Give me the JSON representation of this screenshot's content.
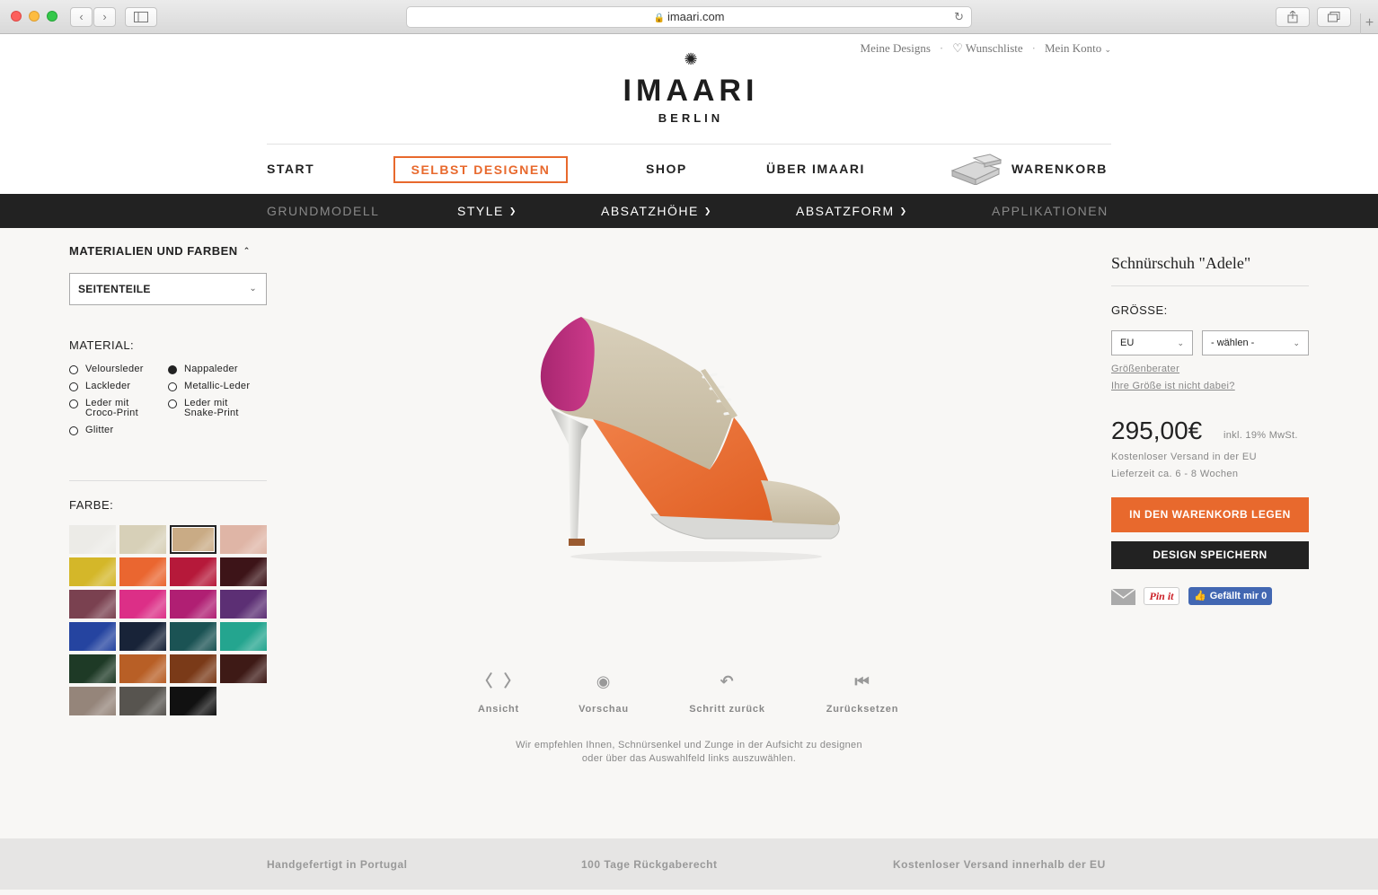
{
  "browser": {
    "url": "imaari.com"
  },
  "header": {
    "top_links": [
      "Meine Designs",
      "Wunschliste",
      "Mein Konto"
    ],
    "logo": "IMAARI",
    "logo_sub": "BERLIN"
  },
  "main_nav": {
    "start": "START",
    "design": "SELBST DESIGNEN",
    "shop": "SHOP",
    "about": "ÜBER IMAARI",
    "cart": "WARENKORB"
  },
  "sub_nav": {
    "grundmodell": "GRUNDMODELL",
    "style": "STYLE",
    "absatzhoehe": "ABSATZHÖHE",
    "absatzform": "ABSATZFORM",
    "applikationen": "APPLIKATIONEN"
  },
  "left_panel": {
    "title": "MATERIALIEN UND FARBEN",
    "part_select": "SEITENTEILE",
    "material_label": "MATERIAL:",
    "materials": [
      {
        "label": "Veloursleder",
        "selected": false
      },
      {
        "label": "Nappaleder",
        "selected": true
      },
      {
        "label": "Lackleder",
        "selected": false
      },
      {
        "label": "Metallic-Leder",
        "selected": false
      },
      {
        "label": "Leder mit Croco-Print",
        "selected": false
      },
      {
        "label": "Leder mit Snake-Print",
        "selected": false
      },
      {
        "label": "Glitter",
        "selected": false
      }
    ],
    "color_label": "FARBE:",
    "swatches": [
      "#ecebe7",
      "#d7d0b8",
      "#c9ab85",
      "#dfb5a6",
      "#d4b729",
      "#ea6630",
      "#b6193a",
      "#3d1418",
      "#7a4150",
      "#dc2f87",
      "#b01f73",
      "#5c2f74",
      "#2544a0",
      "#182338",
      "#1b5354",
      "#24a58f",
      "#1e3a26",
      "#b85f26",
      "#7a3a18",
      "#3e1a16",
      "#95857a",
      "#57544f",
      "#111111"
    ],
    "selected_swatch": 2
  },
  "controls": {
    "view": "Ansicht",
    "preview": "Vorschau",
    "undo": "Schritt zurück",
    "reset": "Zurücksetzen"
  },
  "hint": {
    "line1": "Wir empfehlen Ihnen, Schnürsenkel und Zunge in der Aufsicht zu designen",
    "line2": "oder über das Auswahlfeld links auszuwählen."
  },
  "product": {
    "title": "Schnürschuh \"Adele\"",
    "size_label": "GRÖSSE:",
    "size_system": "EU",
    "size_value": "- wählen -",
    "size_advisor": "Größenberater",
    "size_missing": "Ihre Größe ist nicht dabei?",
    "price": "295,00€",
    "price_note": "inkl. 19% MwSt.",
    "shipping": "Kostenloser Versand in der EU",
    "delivery": "Lieferzeit ca. 6 - 8 Wochen",
    "add_to_cart": "IN DEN WARENKORB LEGEN",
    "save_design": "DESIGN SPEICHERN",
    "pin_label": "Pin it",
    "fb_label": "Gefällt mir 0"
  },
  "footer": {
    "item1": "Handgefertigt in Portugal",
    "item2": "100 Tage Rückgaberecht",
    "item3": "Kostenloser Versand innerhalb der EU"
  },
  "colors": {
    "accent": "#e8692d",
    "dark": "#222222"
  }
}
